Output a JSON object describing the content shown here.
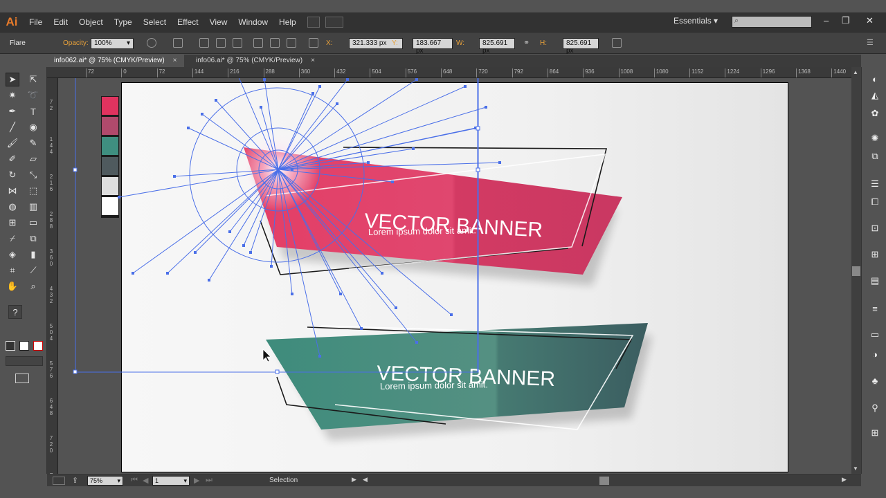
{
  "app": {
    "logo": "Ai"
  },
  "menu": [
    "File",
    "Edit",
    "Object",
    "Type",
    "Select",
    "Effect",
    "View",
    "Window",
    "Help"
  ],
  "workspace": {
    "label": "Essentials"
  },
  "control": {
    "tool_name": "Flare",
    "opacity_label": "Opacity:",
    "opacity_value": "100%",
    "x_label": "X:",
    "x_value": "321.333 px",
    "y_label": "Y:",
    "y_value": "183.667 px",
    "w_label": "W:",
    "w_value": "825.691 px",
    "h_label": "H:",
    "h_value": "825.691 px"
  },
  "tabs": [
    {
      "label": "info062.ai* @ 75% (CMYK/Preview)",
      "active": true
    },
    {
      "label": "info06.ai* @ 75% (CMYK/Preview)",
      "active": false
    }
  ],
  "ruler": {
    "h": [
      "72",
      "0",
      "72",
      "144",
      "216",
      "288",
      "360",
      "432",
      "504",
      "576",
      "648",
      "720",
      "792",
      "864",
      "936",
      "1008",
      "1080",
      "1152",
      "1224",
      "1296",
      "1368",
      "1440"
    ],
    "v": [
      "7 2",
      "1 4 4",
      "2 1 6",
      "2 8 8",
      "3 6 0",
      "4 3 2",
      "5 0 4",
      "5 7 6",
      "6 4 8",
      "7 2 0",
      "7 9 2"
    ]
  },
  "banners": [
    {
      "title": "VECTOR BANNER",
      "subtitle": "Lorem ipsum dolor sit amit."
    },
    {
      "title": "VECTOR BANNER",
      "subtitle": "Lorem ipsum dolor sit amit."
    }
  ],
  "swatches": {
    "colors": [
      "#e0335f",
      "#b04a6c",
      "#3f8f80",
      "#4f5a5e",
      "#dedede",
      "#ffffff"
    ]
  },
  "status": {
    "zoom": "75%",
    "page": "1",
    "tool": "Selection"
  },
  "colors": {
    "accent_pink": "#e23a62",
    "accent_teal": "#3c8a7d",
    "selection": "#4a6fe8"
  }
}
